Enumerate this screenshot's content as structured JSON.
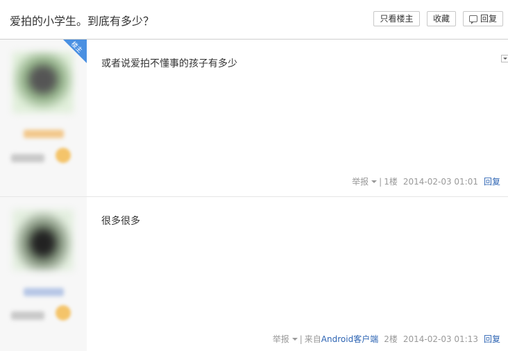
{
  "header": {
    "title": "爱拍的小学生。到底有多少？",
    "buttons": {
      "only_op": "只看楼主",
      "favorite": "收藏",
      "reply": "回复"
    }
  },
  "posts": [
    {
      "is_op": true,
      "op_label": "楼主",
      "content": "或者说爱拍不懂事的孩子有多少",
      "report": "举报",
      "separator": "|",
      "source": "",
      "floor": "1楼",
      "time": "2014-02-03 01:01",
      "reply": "回复"
    },
    {
      "is_op": false,
      "content": "很多很多",
      "report": "举报",
      "separator": "|",
      "source_prefix": "来自",
      "source": "Android客户端",
      "floor": "2楼",
      "time": "2014-02-03 01:13",
      "reply": "回复"
    }
  ]
}
